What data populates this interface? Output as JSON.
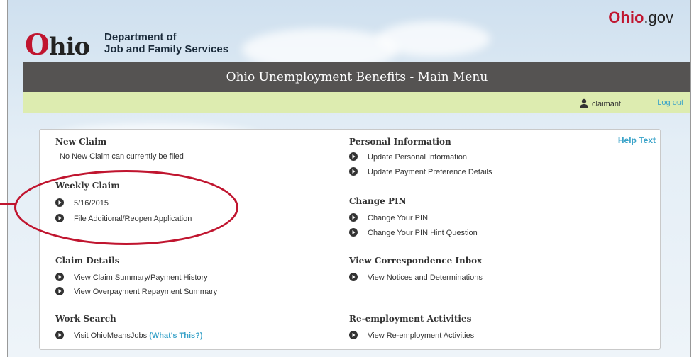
{
  "header": {
    "logo_text": "Ohio",
    "department": "Department of",
    "department_line2": "Job and Family Services",
    "ohiogov_prefix": "Ohio",
    "ohiogov_suffix": ".gov"
  },
  "title": "Ohio Unemployment Benefits - Main Menu",
  "userbar": {
    "username": "claimant",
    "logout": "Log out"
  },
  "help_text": "Help Text",
  "colors": {
    "accent_red": "#c0152f",
    "link_blue": "#3aa3c9",
    "titlebar": "#555352",
    "userbar": "#ddecb0"
  },
  "left": {
    "new_claim": {
      "title": "New Claim",
      "text": "No New Claim can currently be filed"
    },
    "weekly_claim": {
      "title": "Weekly Claim",
      "items": [
        "5/16/2015",
        "File Additional/Reopen Application"
      ]
    },
    "claim_details": {
      "title": "Claim Details",
      "items": [
        "View Claim Summary/Payment History",
        "View Overpayment Repayment Summary"
      ]
    },
    "work_search": {
      "title": "Work Search",
      "item": "Visit OhioMeansJobs",
      "item_link": "(What's This?)"
    }
  },
  "right": {
    "personal_info": {
      "title": "Personal Information",
      "items": [
        "Update Personal Information",
        "Update Payment Preference Details"
      ]
    },
    "change_pin": {
      "title": "Change PIN",
      "items": [
        "Change Your PIN",
        "Change Your PIN Hint Question"
      ]
    },
    "correspondence": {
      "title": "View Correspondence Inbox",
      "items": [
        "View Notices and Determinations"
      ]
    },
    "reemployment": {
      "title": "Re-employment Activities",
      "items": [
        "View Re-employment Activities"
      ]
    }
  }
}
